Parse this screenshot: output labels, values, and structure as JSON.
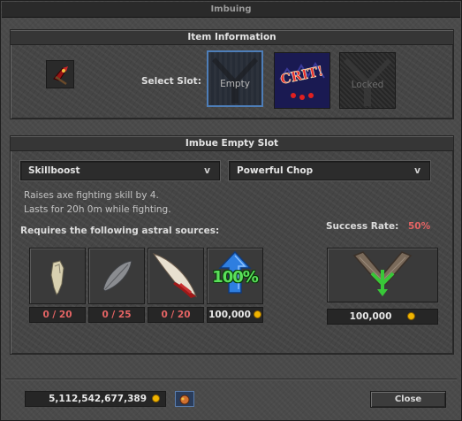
{
  "window": {
    "title": "Imbuing"
  },
  "item_info": {
    "header": "Item Information",
    "select_slot_label": "Select Slot:",
    "slots": [
      {
        "label": "Empty",
        "state": "selected"
      },
      {
        "label": "",
        "image": "crit-icon",
        "state": "imbued"
      },
      {
        "label": "Locked",
        "state": "locked"
      }
    ]
  },
  "imbue_panel": {
    "header": "Imbue Empty Slot",
    "type_dropdown": {
      "value": "Skillboost",
      "arrow": "v"
    },
    "imbuement_dropdown": {
      "value": "Powerful Chop",
      "arrow": "v"
    },
    "description_line1": "Raises axe fighting skill by 4.",
    "description_line2": "Lasts for 20h 0m while fighting.",
    "requires_label": "Requires the following astral sources:",
    "success_label": "Success Rate:",
    "success_value": "50%",
    "sources": [
      {
        "icon": "tooth-icon",
        "count": "0 / 20"
      },
      {
        "icon": "stone-feather-icon",
        "count": "0 / 25"
      },
      {
        "icon": "claw-icon",
        "count": "0 / 20"
      }
    ],
    "protection": {
      "icon": "up-arrow-icon",
      "percent": "100%",
      "cost": "100,000"
    },
    "imbue_cost": "100,000"
  },
  "footer": {
    "balance": "5,112,542,677,389",
    "close_label": "Close"
  },
  "colors": {
    "accent_blue": "#4e7eb8",
    "success_red": "#e46464",
    "coin_gold": "#f0b400",
    "green_arrow": "#38c838"
  }
}
